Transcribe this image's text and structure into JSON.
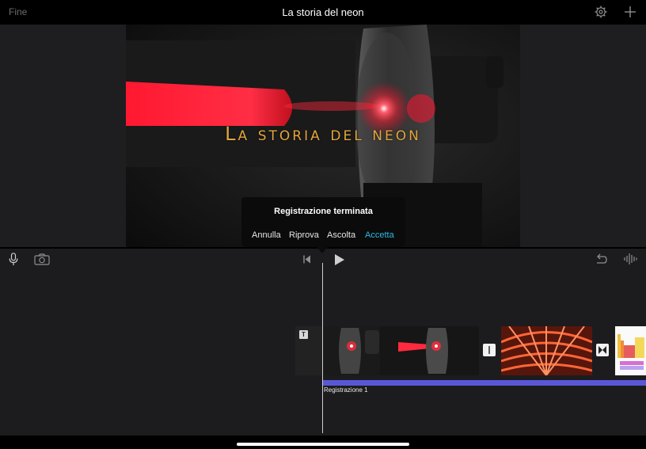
{
  "topbar": {
    "done_label": "Fine",
    "title": "La storia del neon",
    "settings_icon": "gear-icon",
    "add_icon": "plus-icon"
  },
  "viewer": {
    "overlay_title": "La storia del neon"
  },
  "popup": {
    "title": "Registrazione terminata",
    "buttons": {
      "cancel": "Annulla",
      "retry": "Riprova",
      "listen": "Ascolta",
      "accept": "Accetta"
    },
    "accent_color": "#2fb9e6"
  },
  "controls": {
    "mic_icon": "microphone-icon",
    "camera_icon": "camera-icon",
    "rewind_icon": "skip-to-start-icon",
    "play_icon": "play-icon",
    "undo_icon": "undo-icon",
    "audio_icon": "audio-waveform-icon"
  },
  "timeline": {
    "audio_track_label": "Registrazione 1",
    "audio_track_color": "#5a57d6",
    "title_badge": "T"
  }
}
